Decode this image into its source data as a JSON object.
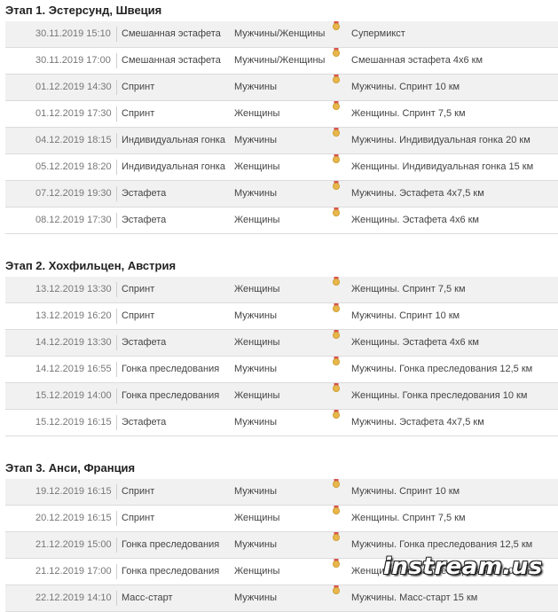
{
  "colors": {
    "medal_gold": "#e8b64b",
    "row_shade": "#f1f1f1"
  },
  "icons": {
    "medal": "medal-icon"
  },
  "stages": [
    {
      "title": "Этап 1. Эстерсунд, Швеция",
      "rows": [
        {
          "date": "30.11.2019 15:10",
          "discipline": "Смешанная эстафета",
          "gender": "Мужчины/Женщины",
          "event": "Супермикст"
        },
        {
          "date": "30.11.2019 17:00",
          "discipline": "Смешанная эстафета",
          "gender": "Мужчины/Женщины",
          "event": "Смешанная эстафета 4х6 км"
        },
        {
          "date": "01.12.2019 14:30",
          "discipline": "Спринт",
          "gender": "Мужчины",
          "event": "Мужчины. Спринт 10 км"
        },
        {
          "date": "01.12.2019 17:30",
          "discipline": "Спринт",
          "gender": "Женщины",
          "event": "Женщины. Спринт 7,5 км"
        },
        {
          "date": "04.12.2019 18:15",
          "discipline": "Индивидуальная гонка",
          "gender": "Мужчины",
          "event": "Мужчины. Индивидуальная гонка 20 км"
        },
        {
          "date": "05.12.2019 18:20",
          "discipline": "Индивидуальная гонка",
          "gender": "Женщины",
          "event": "Женщины. Индивидуальная гонка 15 км"
        },
        {
          "date": "07.12.2019 19:30",
          "discipline": "Эстафета",
          "gender": "Мужчины",
          "event": "Мужчины. Эстафета 4х7,5 км"
        },
        {
          "date": "08.12.2019 17:30",
          "discipline": "Эстафета",
          "gender": "Женщины",
          "event": "Женщины. Эстафета 4х6 км"
        }
      ]
    },
    {
      "title": "Этап 2. Хохфильцен, Австрия",
      "rows": [
        {
          "date": "13.12.2019 13:30",
          "discipline": "Спринт",
          "gender": "Женщины",
          "event": "Женщины. Спринт 7,5 км"
        },
        {
          "date": "13.12.2019 16:20",
          "discipline": "Спринт",
          "gender": "Мужчины",
          "event": "Мужчины. Спринт 10 км"
        },
        {
          "date": "14.12.2019 13:30",
          "discipline": "Эстафета",
          "gender": "Женщины",
          "event": "Женщины. Эстафета 4х6 км"
        },
        {
          "date": "14.12.2019 16:55",
          "discipline": "Гонка преследования",
          "gender": "Мужчины",
          "event": "Мужчины. Гонка преследования 12,5 км"
        },
        {
          "date": "15.12.2019 14:00",
          "discipline": "Гонка преследования",
          "gender": "Женщины",
          "event": "Женщины. Гонка преследования 10 км"
        },
        {
          "date": "15.12.2019 16:15",
          "discipline": "Эстафета",
          "gender": "Мужчины",
          "event": "Мужчины. Эстафета 4х7,5 км"
        }
      ]
    },
    {
      "title": "Этап 3. Анси, Франция",
      "rows": [
        {
          "date": "19.12.2019 16:15",
          "discipline": "Спринт",
          "gender": "Мужчины",
          "event": "Мужчины. Спринт 10 км"
        },
        {
          "date": "20.12.2019 16:15",
          "discipline": "Спринт",
          "gender": "Женщины",
          "event": "Женщины. Спринт 7,5 км"
        },
        {
          "date": "21.12.2019 15:00",
          "discipline": "Гонка преследования",
          "gender": "Мужчины",
          "event": "Мужчины. Гонка преследования 12,5 км"
        },
        {
          "date": "21.12.2019 17:00",
          "discipline": "Гонка преследования",
          "gender": "Женщины",
          "event": "Женщины. Гонка преследования 10 км"
        },
        {
          "date": "22.12.2019 14:10",
          "discipline": "Масс-старт",
          "gender": "Мужчины",
          "event": "Мужчины. Масс-старт 15 км"
        }
      ]
    }
  ],
  "watermark": "instream.us"
}
